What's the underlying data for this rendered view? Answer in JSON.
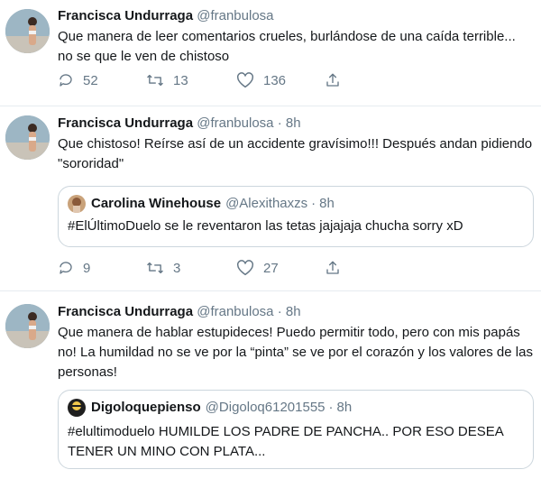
{
  "tweets": [
    {
      "name": "Francisca Undurraga",
      "handle": "@franbulosa",
      "text": "Que manera de leer comentarios crueles, burlándose de una caída terrible... no se que le ven de chistoso",
      "replies": "52",
      "retweets": "13",
      "likes": "136"
    },
    {
      "name": "Francisca Undurraga",
      "handle": "@franbulosa",
      "separator": "·",
      "time": "8h",
      "text": "Que chistoso! Reírse así de un accidente gravísimo!!! Después andan pidiendo \"sororidad\"",
      "quote": {
        "name": "Carolina Winehouse",
        "handle": "@Alexithaxzs",
        "separator": "·",
        "time": "8h",
        "text": "#ElÚltimoDuelo se le reventaron las tetas jajajaja chucha sorry xD"
      },
      "replies": "9",
      "retweets": "3",
      "likes": "27"
    },
    {
      "name": "Francisca Undurraga",
      "handle": "@franbulosa",
      "separator": "·",
      "time": "8h",
      "text": "Que manera de hablar estupideces! Puedo permitir todo, pero con mis papás no! La humildad no se ve por la “pinta” se ve por el corazón y los valores de las personas!",
      "quote": {
        "name": "Digoloquepienso",
        "handle": "@Digoloq61201555",
        "separator": "·",
        "time": "8h",
        "text": "#elultimoduelo HUMILDE LOS PADRE DE PANCHA.. POR ESO DESEA TENER UN MINO CON PLATA..."
      }
    }
  ],
  "icons": {
    "reply": "reply-icon",
    "retweet": "retweet-icon",
    "like": "like-icon",
    "share": "share-icon"
  },
  "colors": {
    "text": "#14171a",
    "secondary": "#657786",
    "border": "#ccd6dd"
  }
}
